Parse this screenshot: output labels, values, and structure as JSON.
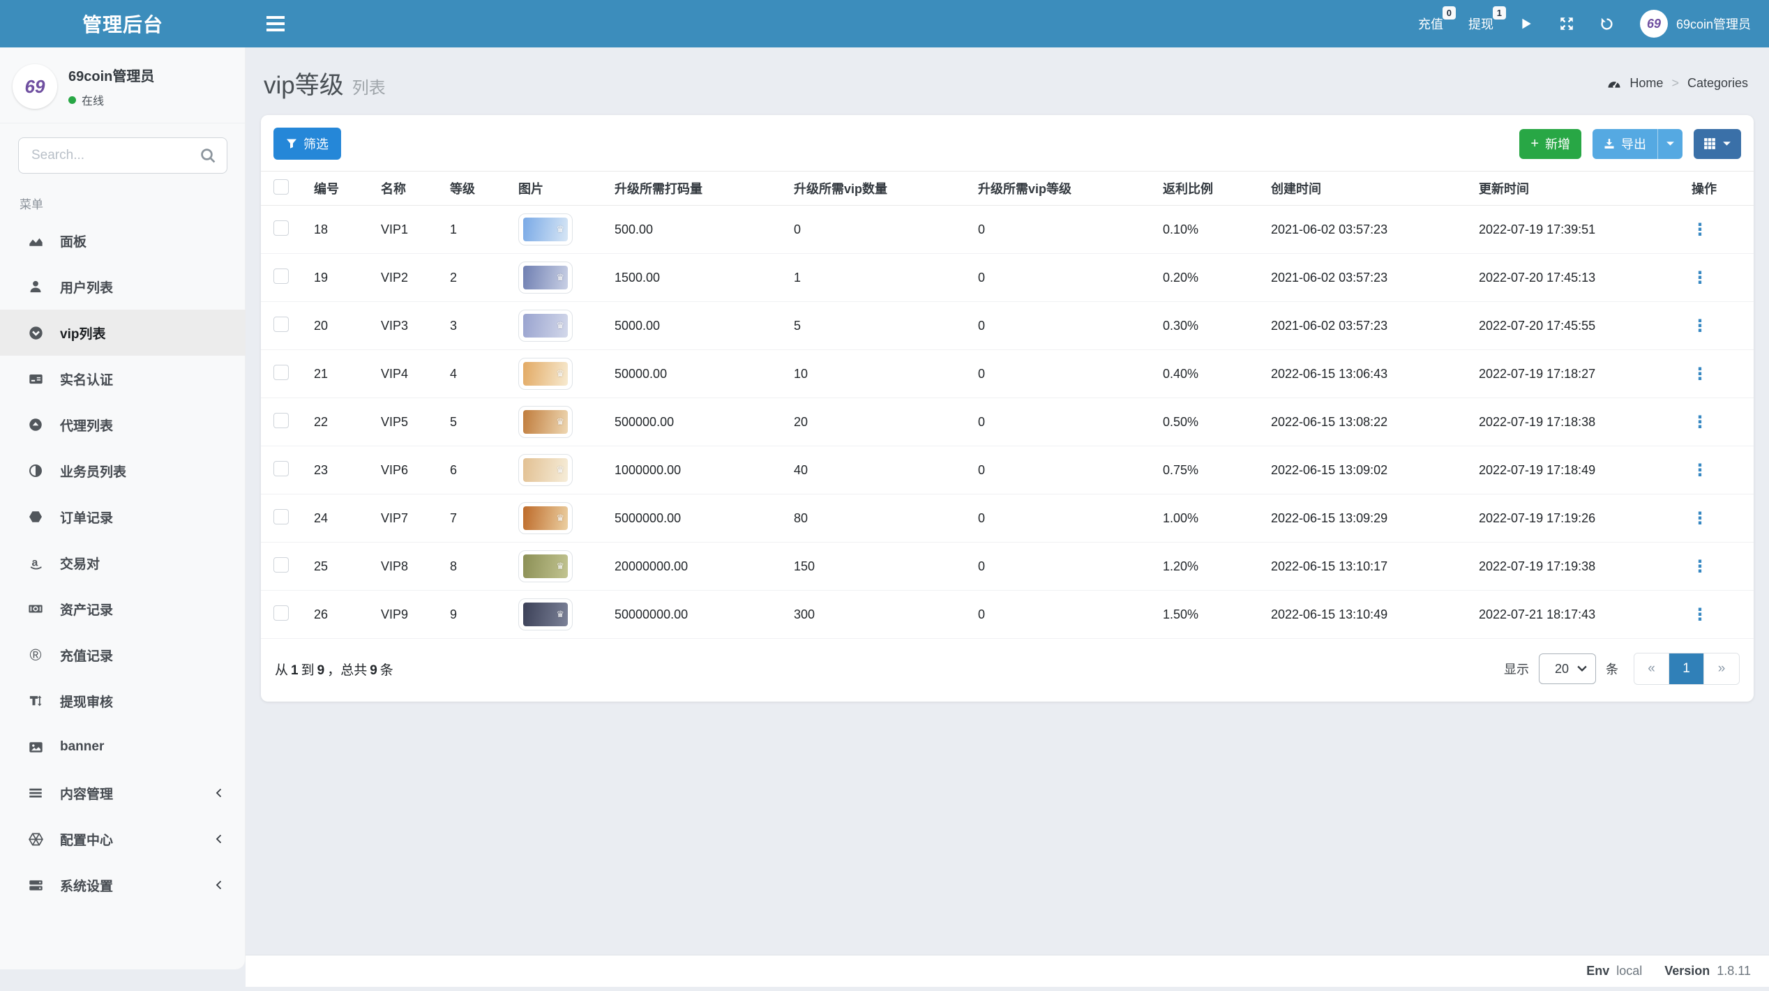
{
  "navbar": {
    "brand": "管理后台",
    "recharge": {
      "label": "充值",
      "badge": "0"
    },
    "withdraw": {
      "label": "提现",
      "badge": "1"
    },
    "avatar_text": "69",
    "username": "69coin管理员"
  },
  "sidebar": {
    "avatar_text": "69",
    "user": {
      "name": "69coin管理员",
      "status": "在线"
    },
    "search_placeholder": "Search...",
    "menu_label": "菜单",
    "items": [
      {
        "label": "面板",
        "icon": "chart-area-icon"
      },
      {
        "label": "用户列表",
        "icon": "user-icon"
      },
      {
        "label": "vip列表",
        "icon": "arrow-circle-down-icon",
        "active": true
      },
      {
        "label": "实名认证",
        "icon": "id-card-icon"
      },
      {
        "label": "代理列表",
        "icon": "caret-circle-up-icon"
      },
      {
        "label": "业务员列表",
        "icon": "adjust-icon"
      },
      {
        "label": "订单记录",
        "icon": "hexagon-icon"
      },
      {
        "label": "交易对",
        "icon": "amazon-icon"
      },
      {
        "label": "资产记录",
        "icon": "money-bill-icon"
      },
      {
        "label": "充值记录",
        "icon": "registered-icon"
      },
      {
        "label": "提现审核",
        "icon": "text-height-icon"
      },
      {
        "label": "banner",
        "icon": "image-icon"
      },
      {
        "label": "内容管理",
        "icon": "bars-icon",
        "expandable": true
      },
      {
        "label": "配置中心",
        "icon": "hexagon-outline-icon",
        "expandable": true
      },
      {
        "label": "系统设置",
        "icon": "server-icon",
        "expandable": true
      }
    ]
  },
  "page": {
    "title": "vip等级",
    "subtitle": "列表",
    "breadcrumb": {
      "home": "Home",
      "current": "Categories"
    }
  },
  "toolbar": {
    "filter_label": "筛选",
    "add_label": "新增",
    "export_label": "导出"
  },
  "table": {
    "headers": [
      "编号",
      "名称",
      "等级",
      "图片",
      "升级所需打码量",
      "升级所需vip数量",
      "升级所需vip等级",
      "返利比例",
      "创建时间",
      "更新时间",
      "操作"
    ],
    "rows": [
      {
        "id": "18",
        "name": "VIP1",
        "level": "1",
        "bet": "500.00",
        "vip_count": "0",
        "vip_level": "0",
        "rebate": "0.10%",
        "created": "2021-06-02 03:57:23",
        "updated": "2022-07-19 17:39:51",
        "img_from": "#79a9e6",
        "img_to": "#d7e6f5"
      },
      {
        "id": "19",
        "name": "VIP2",
        "level": "2",
        "bet": "1500.00",
        "vip_count": "1",
        "vip_level": "0",
        "rebate": "0.20%",
        "created": "2021-06-02 03:57:23",
        "updated": "2022-07-20 17:45:13",
        "img_from": "#6f7fb2",
        "img_to": "#c9d0e5"
      },
      {
        "id": "20",
        "name": "VIP3",
        "level": "3",
        "bet": "5000.00",
        "vip_count": "5",
        "vip_level": "0",
        "rebate": "0.30%",
        "created": "2021-06-02 03:57:23",
        "updated": "2022-07-20 17:45:55",
        "img_from": "#99a3cf",
        "img_to": "#d3d8ea"
      },
      {
        "id": "21",
        "name": "VIP4",
        "level": "4",
        "bet": "50000.00",
        "vip_count": "10",
        "vip_level": "0",
        "rebate": "0.40%",
        "created": "2022-06-15 13:06:43",
        "updated": "2022-07-19 17:18:27",
        "img_from": "#e2a963",
        "img_to": "#f7ead0"
      },
      {
        "id": "22",
        "name": "VIP5",
        "level": "5",
        "bet": "500000.00",
        "vip_count": "20",
        "vip_level": "0",
        "rebate": "0.50%",
        "created": "2022-06-15 13:08:22",
        "updated": "2022-07-19 17:18:38",
        "img_from": "#c07c3c",
        "img_to": "#eed7b2"
      },
      {
        "id": "23",
        "name": "VIP6",
        "level": "6",
        "bet": "1000000.00",
        "vip_count": "40",
        "vip_level": "0",
        "rebate": "0.75%",
        "created": "2022-06-15 13:09:02",
        "updated": "2022-07-19 17:18:49",
        "img_from": "#e2c092",
        "img_to": "#f6edd9"
      },
      {
        "id": "24",
        "name": "VIP7",
        "level": "7",
        "bet": "5000000.00",
        "vip_count": "80",
        "vip_level": "0",
        "rebate": "1.00%",
        "created": "2022-06-15 13:09:29",
        "updated": "2022-07-19 17:19:26",
        "img_from": "#bd6a29",
        "img_to": "#ecd0a2"
      },
      {
        "id": "25",
        "name": "VIP8",
        "level": "8",
        "bet": "20000000.00",
        "vip_count": "150",
        "vip_level": "0",
        "rebate": "1.20%",
        "created": "2022-06-15 13:10:17",
        "updated": "2022-07-19 17:19:38",
        "img_from": "#8b8f55",
        "img_to": "#c2c491"
      },
      {
        "id": "26",
        "name": "VIP9",
        "level": "9",
        "bet": "50000000.00",
        "vip_count": "300",
        "vip_level": "0",
        "rebate": "1.50%",
        "created": "2022-06-15 13:10:49",
        "updated": "2022-07-21 18:17:43",
        "img_from": "#3b4057",
        "img_to": "#7c8298"
      }
    ],
    "summary": {
      "t1": "从",
      "n1": "1",
      "t2": "到",
      "n2": "9",
      "t3": "，总共",
      "n3": "9",
      "t4": "条"
    }
  },
  "pagination": {
    "show_label": "显示",
    "per_page": "20",
    "unit_label": "条",
    "prev": "«",
    "page": "1",
    "next": "»"
  },
  "footer": {
    "env_label": "Env",
    "env_value": "local",
    "version_label": "Version",
    "version_value": "1.8.11"
  },
  "colors": {
    "navbar": "#3c8dbc",
    "logo_purple": "#6f4fa0",
    "filter_btn": "#2587d8",
    "add_btn": "#28a745",
    "export_btn": "#55a9e2",
    "view_btn": "#3a70a8",
    "active_page": "#3080b8",
    "status_online": "#28a745",
    "action_dots": "#3788c2"
  }
}
